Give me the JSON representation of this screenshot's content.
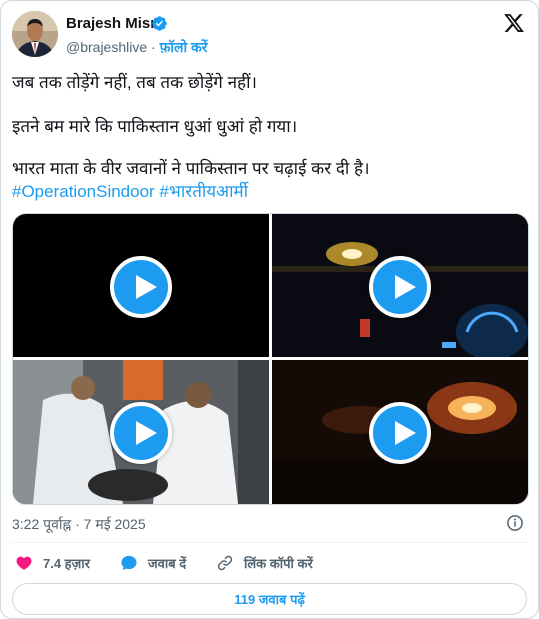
{
  "author": {
    "name": "Brajesh Misra",
    "handle": "@brajeshlive",
    "separator": "·",
    "follow_label": "फ़ॉलो करें"
  },
  "tweet": {
    "lines": [
      "जब तक तोड़ेंगे नहीं, तब तक छोड़ेंगे नहीं।",
      "इतने बम मारे कि पाकिस्तान धुआं धुआं हो गया।",
      "भारत माता के वीर जवानों ने पाकिस्तान पर चढ़ाई कर दी है।"
    ],
    "hashtags": "#OperationSindoor #भारतीयआर्मी"
  },
  "media": {
    "videos": [
      {
        "icon": "play-icon"
      },
      {
        "icon": "play-icon"
      },
      {
        "icon": "play-icon"
      },
      {
        "icon": "play-icon"
      }
    ]
  },
  "meta": {
    "timestamp": "3:22 पूर्वाह्न · 7 मई 2025"
  },
  "actions": {
    "likes": "7.4 हज़ार",
    "reply_label": "जवाब दें",
    "copy_link_label": "लिंक कॉपी करें"
  },
  "replies_button": "119 जवाब पढ़ें",
  "colors": {
    "accent": "#1d9bf0",
    "like": "#f91880",
    "text": "#0f1419",
    "muted": "#536471"
  }
}
